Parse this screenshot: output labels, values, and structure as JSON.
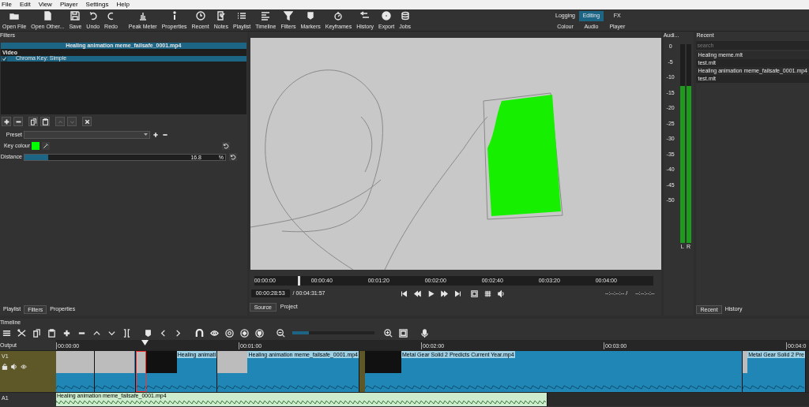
{
  "menu": [
    "File",
    "Edit",
    "View",
    "Player",
    "Settings",
    "Help"
  ],
  "toolbar": [
    "Open File",
    "Open Other...",
    "Save",
    "Undo",
    "Redo",
    "Peak Meter",
    "Properties",
    "Recent",
    "Notes",
    "Playlist",
    "Timeline",
    "Filters",
    "Markers",
    "Keyframes",
    "History",
    "Export",
    "Jobs"
  ],
  "layouts": [
    {
      "label": "Logging",
      "selected": false
    },
    {
      "label": "Editing",
      "selected": true
    },
    {
      "label": "FX",
      "selected": false
    },
    {
      "label": "Colour",
      "selected": false
    },
    {
      "label": "Audio",
      "selected": false
    },
    {
      "label": "Player",
      "selected": false
    }
  ],
  "filters": {
    "title": "Filters",
    "clip": "Healing animation meme_failsafe_0001.mp4",
    "group": "Video",
    "items": [
      {
        "label": "Chroma Key: Simple",
        "checked": true,
        "selected": true
      }
    ],
    "preset_label": "Preset",
    "key_colour": {
      "label": "Key colour",
      "color": "#00ff00"
    },
    "distance": {
      "label": "Distance",
      "level": 0.12,
      "value": "16.8",
      "unit": "%"
    }
  },
  "left_tabs": [
    {
      "label": "Playlist",
      "selected": false
    },
    {
      "label": "Filters",
      "selected": true
    },
    {
      "label": "Properties",
      "selected": false
    }
  ],
  "viewer": {
    "ruler": [
      "00:00:00",
      "00:00:40",
      "00:01:20",
      "00:02:00",
      "00:02:40",
      "00:03:20",
      "00:04:00"
    ],
    "playhead": {
      "level": 0.11
    },
    "timecode": "00:00:28:53",
    "duration": "/ 00:04:31:57",
    "in_point": "--:--:--:-- /",
    "out_point": "--:--:--:--",
    "tabs": [
      {
        "label": "Source",
        "selected": true
      },
      {
        "label": "Project",
        "selected": false
      }
    ]
  },
  "audio_meter": {
    "title": "Audi...",
    "scale": [
      "0",
      "-5",
      "-10",
      "-15",
      "-20",
      "-25",
      "-30",
      "-35",
      "-40",
      "-45",
      "-50"
    ],
    "channels": [
      {
        "label": "L",
        "level": 0.79
      },
      {
        "label": "R",
        "level": 0.79
      }
    ]
  },
  "recent": {
    "title": "Recent",
    "search_placeholder": "search",
    "items": [
      "Healing meme.mlt",
      "test.mlt",
      "Healing animation meme_failsafe_0001.mp4",
      "test.mlt"
    ],
    "tabs": [
      {
        "label": "Recent",
        "selected": true
      },
      {
        "label": "History",
        "selected": false
      }
    ]
  },
  "timeline": {
    "title": "Timeline",
    "zoom": {
      "level": 0.2
    },
    "ruler": [
      "00:00:00",
      "00:01:00",
      "00:02:00",
      "00:03:00",
      "00:04:0"
    ],
    "output_label": "Output",
    "tracks": [
      {
        "name": "V1",
        "kind": "video",
        "clips": [
          {
            "selected": false
          },
          {
            "selected": false
          },
          {
            "selected": true
          },
          {
            "label": "Healing animati",
            "selected": false
          },
          {
            "label": "Healing animation meme_failsafe_0001.mp4",
            "selected": false
          },
          {
            "label": "Metal Gear Solid 2 Predicts Current Year.mp4",
            "selected": false
          },
          {
            "label": "Metal Gear Solid 2 Pre",
            "selected": false
          }
        ]
      },
      {
        "name": "A1",
        "kind": "audio",
        "clips": [
          {
            "label": "Healing animation meme_failsafe_0001.mp4",
            "selected": false
          }
        ]
      }
    ]
  }
}
